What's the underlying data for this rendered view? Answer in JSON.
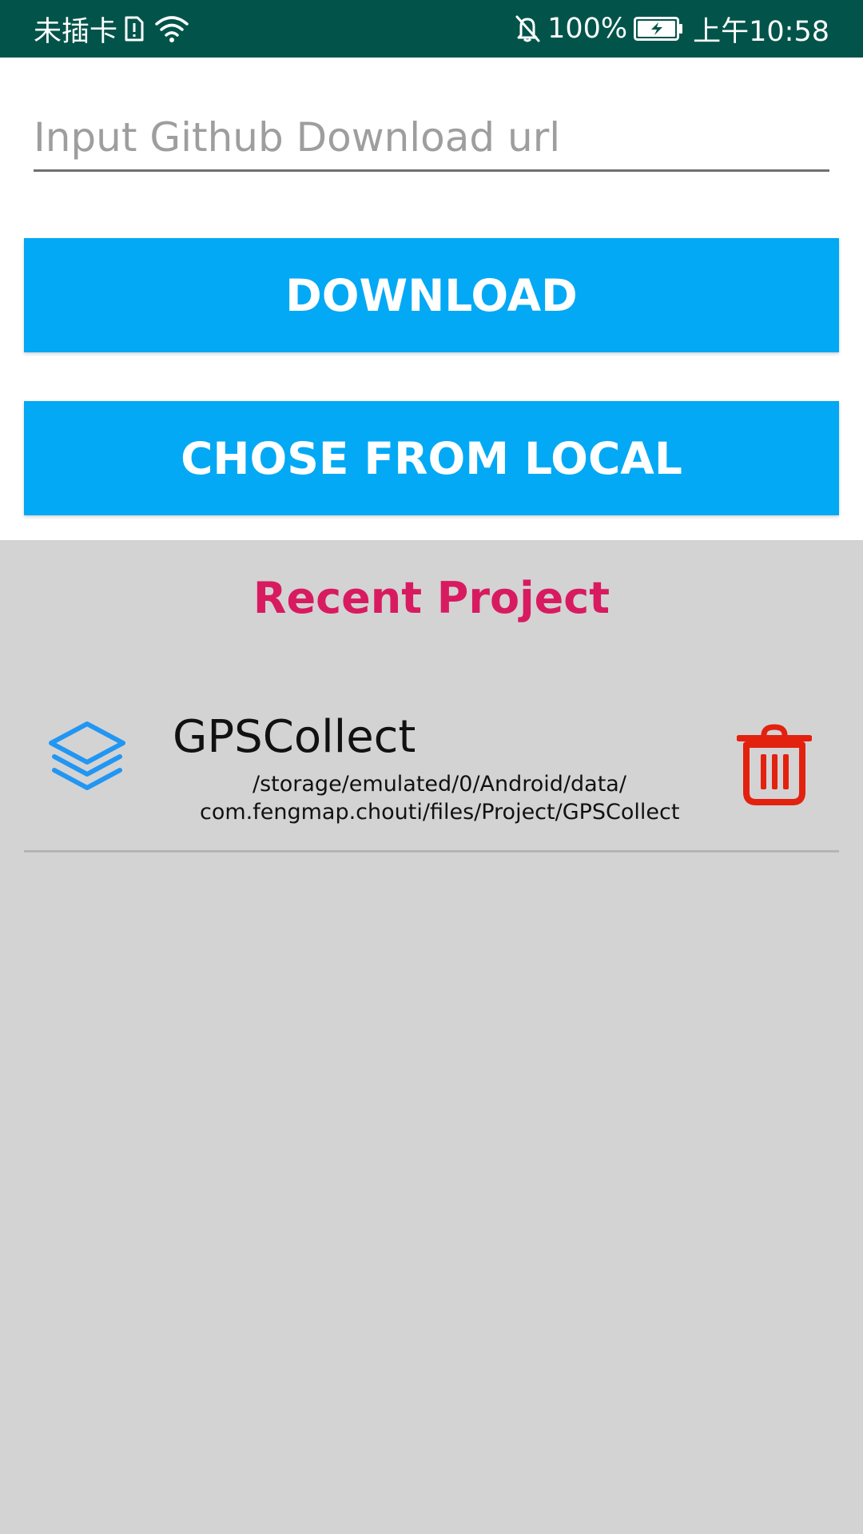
{
  "status_bar": {
    "carrier": "未插卡",
    "battery_percent": "100%",
    "time": "上午10:58",
    "icons": [
      "sim-alert-icon",
      "wifi-icon",
      "mute-bell-icon",
      "battery-charging-icon"
    ]
  },
  "download_form": {
    "url_placeholder": "Input Github Download url",
    "url_value": "",
    "download_label": "DOWNLOAD",
    "local_label": "CHOSE FROM LOCAL"
  },
  "recent": {
    "title": "Recent Project",
    "projects": [
      {
        "icon": "layers-icon",
        "name": "GPSCollect",
        "path_line1": "/storage/emulated/0/Android/data/",
        "path_line2": "com.fengmap.chouti/files/Project/GPSCollect",
        "delete_icon": "trash-icon"
      }
    ]
  },
  "colors": {
    "status_bar": "#02544a",
    "button": "#03a9f4",
    "recent_title": "#d81b60",
    "project_icon": "#2196f3",
    "delete_icon": "#e3210f",
    "list_background": "#d3d3d3"
  }
}
